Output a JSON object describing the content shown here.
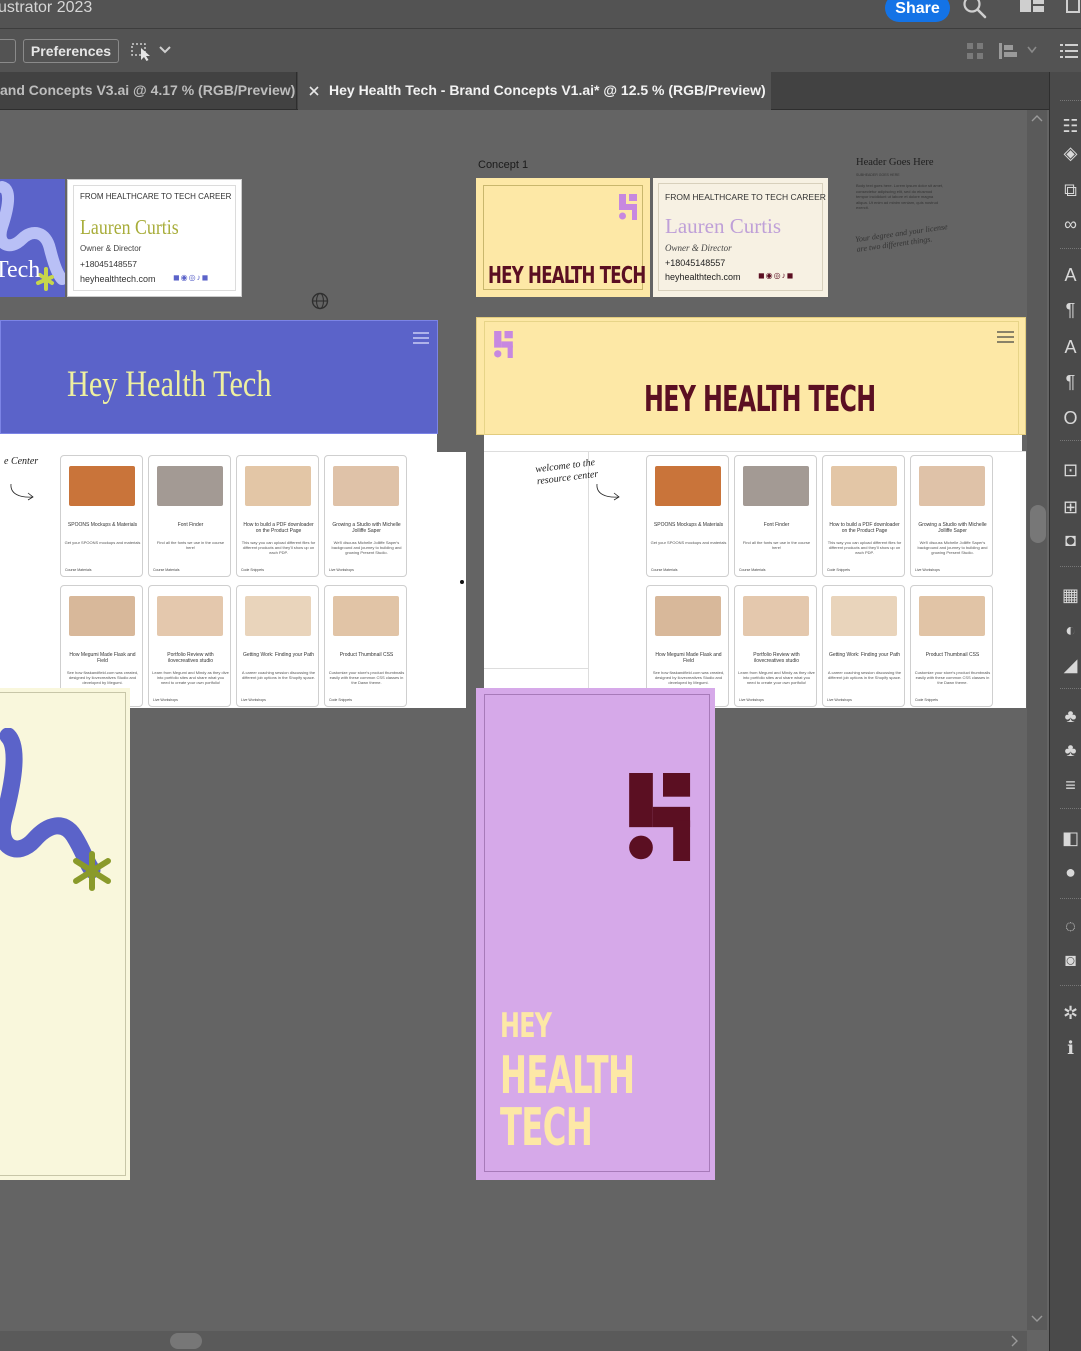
{
  "app": {
    "title": "ustrator 2023",
    "share_label": "Share",
    "preferences_label": "Preferences"
  },
  "tabs": [
    {
      "label": "and Concepts V3.ai @ 4.17 % (RGB/Preview)"
    },
    {
      "label": "Hey Health Tech - Brand Concepts V1.ai* @ 12.5 % (RGB/Preview)"
    }
  ],
  "colors": {
    "accent": "#1473e6",
    "brand_blue": "#5b63c9",
    "brand_yellow": "#fde8a6",
    "brand_maroon": "#5b0f22",
    "brand_purple": "#d6a9e9",
    "brand_cream": "#f9f7dc",
    "brand_green": "#8a9a2a"
  },
  "canvas": {
    "left_concept": {
      "biz_card_heading": "FROM HEALTHCARE TO TECH CAREER",
      "biz_card_name": "Lauren Curtis",
      "biz_card_role": "Owner & Director",
      "biz_card_phone": "+18045148557",
      "biz_card_web": "heyhealthtech.com",
      "logo_fragment": "Tech",
      "website_title": "Hey Health Tech",
      "script_fragment": "e Center"
    },
    "concept1": {
      "label": "Concept 1",
      "card_wordmark": "HEY HEALTH TECH",
      "biz_card_heading": "FROM HEALTHCARE TO TECH CAREER",
      "biz_card_name": "Lauren Curtis",
      "biz_card_role": "Owner & Director",
      "biz_card_phone": "+18045148557",
      "biz_card_web": "heyhealthtech.com",
      "website_title": "HEY HEALTH TECH",
      "welcome_script": "welcome to the resource center",
      "poster_line1": "HEY",
      "poster_line2": "HEALTH",
      "poster_line3": "TECH"
    },
    "type_specimen": {
      "header": "Header Goes Here",
      "subheader": "SUBHEADER GOES HERE",
      "body": "Body text goes here. Lorem ipsum dolor sit amet, consectetur adipiscing elit, sed do eiusmod tempor incididunt ut labore et dolore magna aliqua. Ut enim ad minim veniam, quis nostrud exercit.",
      "script": "Your degree and your license are two different things."
    },
    "resource_cards": [
      {
        "title": "SPOONS Mockups & Materials",
        "desc": "Get your SPOONS mockups and materials",
        "tag": "Course Materials"
      },
      {
        "title": "Font Finder",
        "desc": "Find all the fonts we use in the course here!",
        "tag": "Course Materials"
      },
      {
        "title": "How to build a PDF downloader on the Product Page",
        "desc": "This way you can upload different files for different products and they'll show up on each PDP.",
        "tag": "Code Snippets"
      },
      {
        "title": "Growing a Studio with Michelle Jolliffe Saper",
        "desc": "We'll discuss Michelle Jolliffe Saper's background and journey to building and growing Present Studio.",
        "tag": "Live Workshops"
      },
      {
        "title": "How Megumi Made Flask and Field",
        "desc": "See how flaskandfield.com was created, designed by ilovecreatives Studio and developed by Megumi.",
        "tag": ""
      },
      {
        "title": "Portfolio Review with ilovecreatives studio",
        "desc": "Learn from Megumi and Mindy as they dive into portfolio sites and share what you need to create your own portfolio!",
        "tag": "Live Workshops"
      },
      {
        "title": "Getting Work: Finding your Path",
        "desc": "A career coaching session discussing the different job options in the Shopify space.",
        "tag": "Live Workshops"
      },
      {
        "title": "Product Thumbnail CSS",
        "desc": "Customize your store's product thumbnails easily with these common CSS classes in the Dawn theme.",
        "tag": "Code Snippets"
      }
    ]
  }
}
